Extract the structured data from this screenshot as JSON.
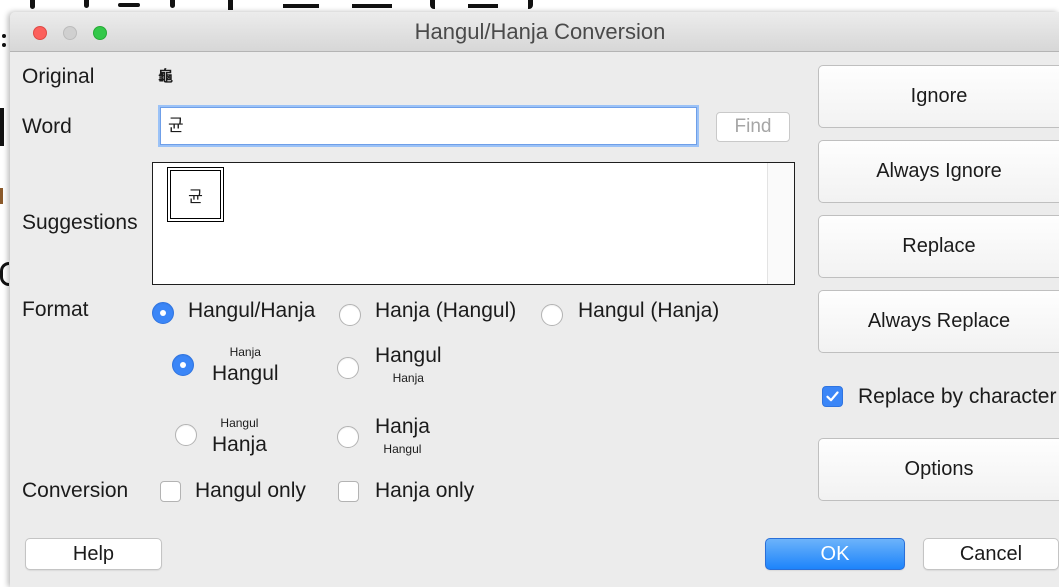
{
  "window": {
    "title": "Hangul/Hanja Conversion",
    "controls": {
      "close": "close-icon",
      "minimize": "minimize-icon",
      "zoom": "zoom-icon"
    }
  },
  "theme": {
    "accent": "#3b86f7",
    "default_button": "#1d84fb"
  },
  "original": {
    "label": "Original",
    "value": "龜"
  },
  "word": {
    "label": "Word",
    "value": "균",
    "find_button": {
      "label": "Find",
      "enabled": false
    }
  },
  "suggestions": {
    "label": "Suggestions",
    "items": [
      {
        "text": "균",
        "selected": true
      }
    ]
  },
  "format": {
    "label": "Format",
    "options": [
      {
        "label": "Hangul/Hanja",
        "selected": true
      },
      {
        "label": "Hanja (Hangul)",
        "selected": false
      },
      {
        "label": "Hangul (Hanja)",
        "selected": false
      }
    ],
    "ruby_options": [
      {
        "annotation": "Hanja",
        "base": "Hangul",
        "selected": true
      },
      {
        "base": "Hangul",
        "annotation": "Hanja",
        "selected": false
      },
      {
        "annotation": "Hangul",
        "base": "Hanja",
        "selected": false
      },
      {
        "base": "Hanja",
        "annotation": "Hangul",
        "selected": false
      }
    ]
  },
  "conversion": {
    "label": "Conversion",
    "options": [
      {
        "label": "Hangul only",
        "checked": false
      },
      {
        "label": "Hanja only",
        "checked": false
      }
    ]
  },
  "actions": {
    "ignore": "Ignore",
    "always_ignore": "Always Ignore",
    "replace": "Replace",
    "always_replace": "Always Replace",
    "replace_by_character": {
      "label": "Replace by character",
      "checked": true
    },
    "options": "Options"
  },
  "footer": {
    "help": "Help",
    "ok": "OK",
    "cancel": "Cancel"
  }
}
